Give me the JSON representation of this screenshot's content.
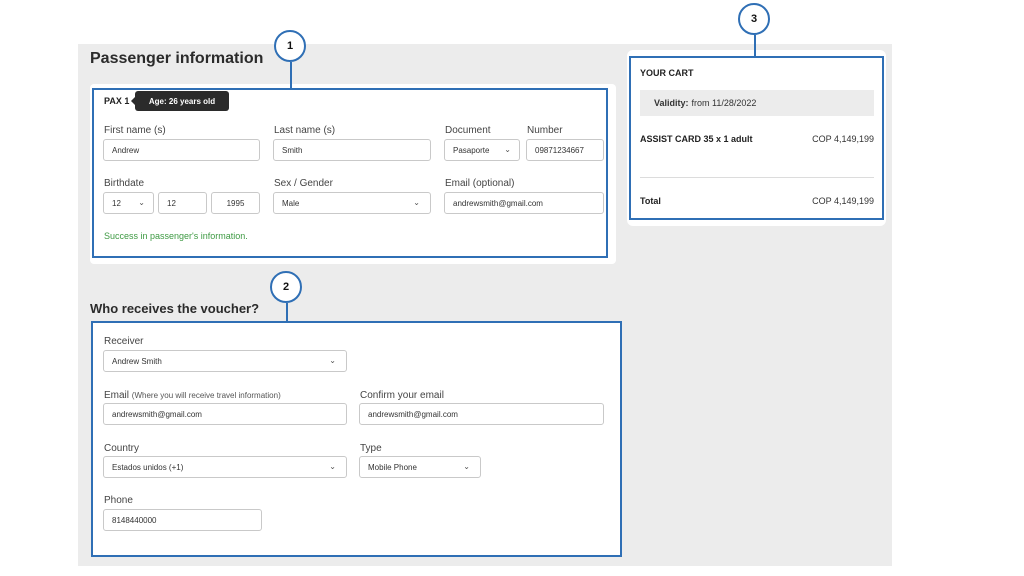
{
  "passenger": {
    "title": "Passenger information",
    "pax_label": "PAX 1",
    "age_tooltip": "Age: 26 years old",
    "first_name": {
      "label": "First name (s)",
      "value": "Andrew"
    },
    "last_name": {
      "label": "Last name (s)",
      "value": "Smith"
    },
    "document": {
      "label": "Document",
      "value": "Pasaporte"
    },
    "number": {
      "label": "Number",
      "value": "09871234667"
    },
    "birthdate": {
      "label": "Birthdate",
      "day": "12",
      "month": "12",
      "year": "1995"
    },
    "sex": {
      "label": "Sex / Gender",
      "value": "Male"
    },
    "email": {
      "label": "Email (optional)",
      "value": "andrewsmith@gmail.com"
    },
    "success": "Success in passenger's information."
  },
  "voucher": {
    "title": "Who receives the voucher?",
    "receiver": {
      "label": "Receiver",
      "value": "Andrew Smith"
    },
    "email": {
      "label": "Email",
      "hint": "(Where you will receive travel information)",
      "value": "andrewsmith@gmail.com"
    },
    "confirm_email": {
      "label": "Confirm your email",
      "value": "andrewsmith@gmail.com"
    },
    "country": {
      "label": "Country",
      "value": "Estados unidos (+1)"
    },
    "type": {
      "label": "Type",
      "value": "Mobile Phone"
    },
    "phone": {
      "label": "Phone",
      "value": "8148440000"
    }
  },
  "cart": {
    "title": "YOUR CART",
    "validity_label": "Validity:",
    "validity_value": "from 11/28/2022",
    "item_name": "ASSIST CARD 35 x 1 adult",
    "item_price": "COP 4,149,199",
    "total_label": "Total",
    "total_value": "COP 4,149,199"
  },
  "markers": [
    "1",
    "2",
    "3"
  ],
  "colors": {
    "frame": "#2f6fb5",
    "success": "#3e9a43",
    "tooltip": "#2b2b2b",
    "stage": "#ececec"
  },
  "icons": {
    "dropdown": "chevron-down-icon"
  }
}
